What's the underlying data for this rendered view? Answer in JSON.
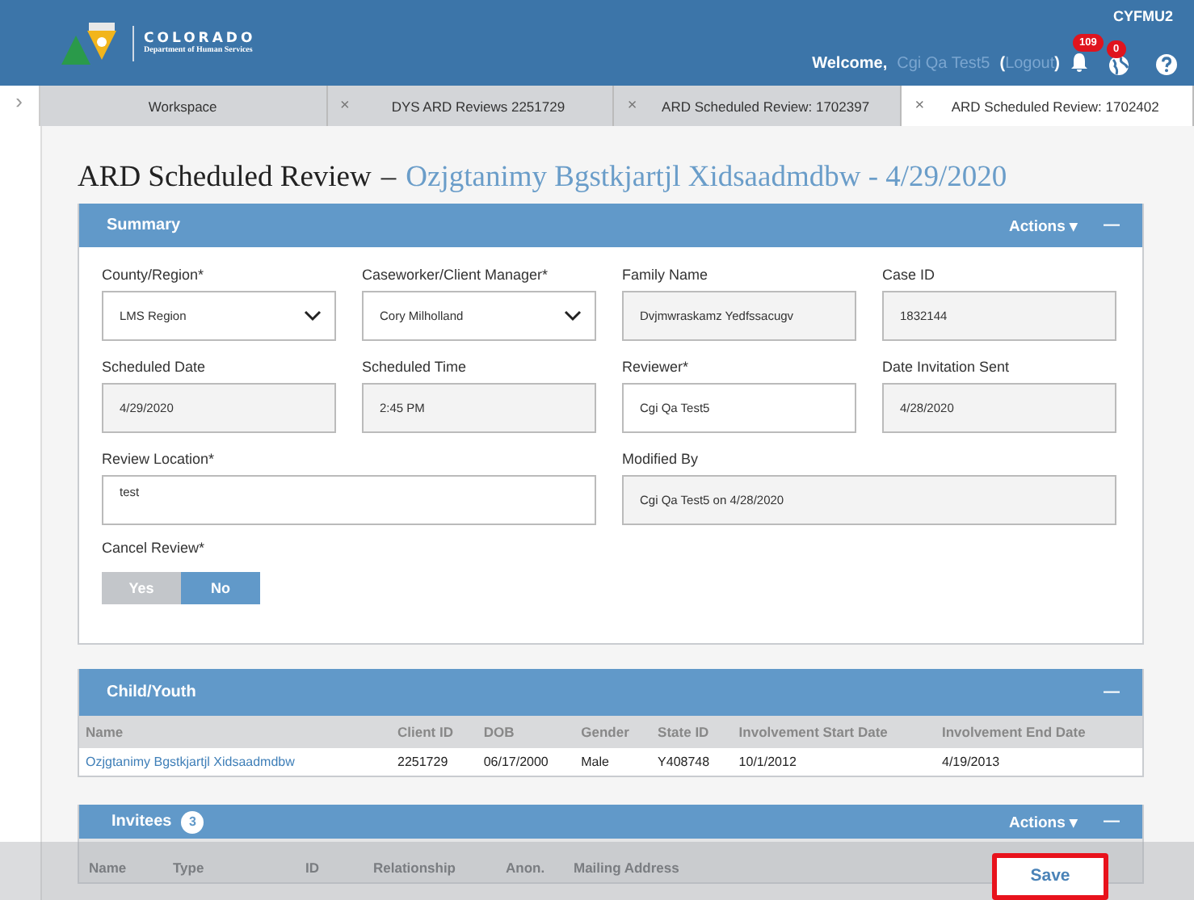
{
  "header": {
    "org": "COLORADO",
    "department": "Department of Human Services",
    "welcome": "Welcome,",
    "user": "Cgi Qa Test5",
    "open_paren": "(",
    "logout": "Logout",
    "close_paren": ")",
    "notifications": "109",
    "globe_count": "0",
    "user_code": "CYFMU2"
  },
  "sidebar_toggle": "›",
  "tabs": [
    {
      "label": "Workspace",
      "selected": false
    },
    {
      "label": "DYS ARD Reviews 2251729",
      "close": "×",
      "selected": false
    },
    {
      "label": "ARD Scheduled Review: 1702397",
      "close": "×",
      "selected": false
    },
    {
      "label": "ARD Scheduled Review: 1702402",
      "close": "×",
      "selected": true
    }
  ],
  "page_title": {
    "main": "ARD Scheduled Review",
    "dash": "–",
    "subject": "Ozjgtanimy Bgstkjartjl Xidsaadmdbw - 4/29/2020"
  },
  "summary": {
    "title": "Summary",
    "actions": "Actions ▾",
    "collapse": "—",
    "fields": [
      {
        "label": "County/Region*",
        "value": "LMS Region",
        "kind": "select"
      },
      {
        "label": "Caseworker/Client Manager*",
        "value": "Cory Milholland",
        "kind": "select"
      },
      {
        "label": "Family Name",
        "value": "Dvjmwraskamz Yedfssacugv",
        "kind": "readonly"
      },
      {
        "label": "Case ID",
        "value": "1832144",
        "kind": "readonly"
      },
      {
        "label": "Scheduled Date",
        "value": "4/29/2020",
        "kind": "readonly"
      },
      {
        "label": "Scheduled Time",
        "value": "2:45 PM",
        "kind": "readonly"
      },
      {
        "label": "Reviewer*",
        "value": "Cgi Qa Test5",
        "kind": "input"
      },
      {
        "label": "Date Invitation Sent",
        "value": "4/28/2020",
        "kind": "readonly"
      },
      {
        "label": "Review Location*",
        "value": "test",
        "kind": "textarea"
      },
      {
        "label": "Modified By",
        "value": "Cgi Qa Test5 on 4/28/2020",
        "kind": "readonly_wide"
      }
    ],
    "cancel_review": {
      "label": "Cancel Review*",
      "options": [
        {
          "label": "Yes",
          "selected": false
        },
        {
          "label": "No",
          "selected": true
        }
      ]
    }
  },
  "child_youth": {
    "title": "Child/Youth",
    "collapse": "—",
    "columns": [
      "Name",
      "Client ID",
      "DOB",
      "Gender",
      "State ID",
      "Involvement Start Date",
      "Involvement End Date"
    ],
    "rows": [
      [
        "Ozjgtanimy Bgstkjartjl Xidsaadmdbw",
        "2251729",
        "06/17/2000",
        "Male",
        "Y408748",
        "10/1/2012",
        "4/19/2013"
      ]
    ]
  },
  "invitees": {
    "title": "Invitees",
    "count": "3",
    "actions": "Actions ▾",
    "collapse": "—",
    "columns": [
      "Name",
      "Type",
      "ID",
      "Relationship",
      "Anon.",
      "Mailing Address"
    ]
  },
  "save_button": "Save"
}
